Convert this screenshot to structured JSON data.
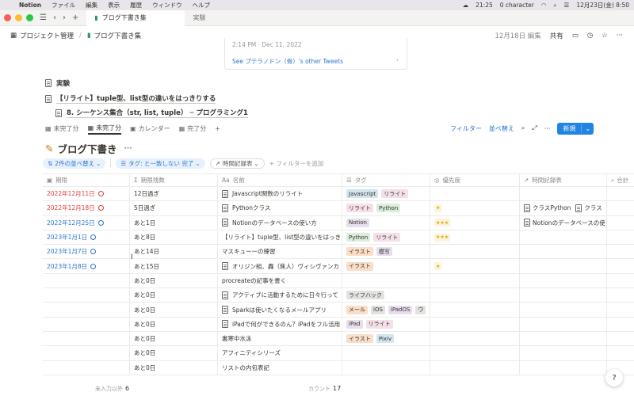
{
  "menubar": {
    "apple": "",
    "app": "Notion",
    "items": [
      "ファイル",
      "編集",
      "表示",
      "履歴",
      "ウィンドウ",
      "ヘルプ"
    ],
    "time": "21:25",
    "char_count": "0 character",
    "datetime": "12月23日(金) 8:50"
  },
  "window": {
    "tab_active": "ブログ下書き集",
    "tab_inactive": "実験"
  },
  "pagebar": {
    "crumb1": "プロジェクト管理",
    "crumb2": "ブログ下書き集",
    "edited": "12月18日 編集",
    "share": "共有"
  },
  "tweet": {
    "time": "2:14 PM · Dec 11, 2022",
    "link": "See プテラノドン（骨）'s other Tweets"
  },
  "blocks": {
    "page1": "実験",
    "page2": "【リライト】tuple型、list型の違いをはっきりする",
    "page3": "8. シーケンス集合（str, list, tuple） ─ プログラミング1"
  },
  "views": {
    "v1": "未完了分",
    "v2": "未完了分",
    "v3": "カレンダー",
    "v4": "完了分",
    "plus": "+",
    "filter": "フィルター",
    "sort": "並べ替え",
    "new": "新規"
  },
  "db": {
    "title": "ブログ下書き",
    "more": "···"
  },
  "filters": {
    "sort": "2件の並べ替え",
    "tag": "タグ: と一致しない 完了",
    "time": "時間記録表",
    "add": "+ フィルターを追加"
  },
  "headers": [
    "期限",
    "期限残数",
    "名前",
    "タグ",
    "優先度",
    "時間記録表",
    "合計"
  ],
  "rows": [
    {
      "date": "2022年12月11日",
      "dc": "red",
      "rem": "12日過ぎ",
      "name": "Javascript関数のリライト",
      "doc": true,
      "tags": [
        [
          "Javascript",
          "#d3e5ef"
        ],
        [
          "リライト",
          "#f5e0e9"
        ]
      ],
      "stars": "",
      "rel": []
    },
    {
      "date": "2022年12月18日",
      "dc": "red",
      "rem": "5日過ぎ",
      "name": "Pythonクラス",
      "doc": true,
      "tags": [
        [
          "リライト",
          "#f5e0e9"
        ],
        [
          "Python",
          "#dbeddb"
        ]
      ],
      "stars": "★",
      "rel": [
        "クラスPython",
        "クラス"
      ]
    },
    {
      "date": "2022年12月25日",
      "dc": "blue",
      "rem": "あと1日",
      "name": "Notionのデータベースの使い方",
      "doc": true,
      "tags": [
        [
          "Notion",
          "#e8deee"
        ]
      ],
      "stars": "★★★",
      "rel": [
        "Notionのデータベースの使"
      ]
    },
    {
      "date": "2023年1月1日",
      "dc": "blue",
      "rem": "あと8日",
      "name": "【リライト】tuple型、list型の違いをはっき",
      "doc": false,
      "tags": [
        [
          "Python",
          "#dbeddb"
        ],
        [
          "リライト",
          "#f5e0e9"
        ]
      ],
      "stars": "★★★",
      "rel": []
    },
    {
      "date": "2023年1月7日",
      "dc": "blue",
      "rem": "あと14日",
      "name": "マスキューーの練習",
      "doc": false,
      "tags": [
        [
          "イラスト",
          "#fadec9"
        ],
        [
          "模写",
          "#e8deee"
        ]
      ],
      "stars": "",
      "rel": []
    },
    {
      "date": "2023年1月8日",
      "dc": "blue",
      "rem": "あと15日",
      "name": "オリジン組、轟（焦人）ヴィシヴァンカ",
      "doc": true,
      "tags": [
        [
          "イラスト",
          "#fadec9"
        ]
      ],
      "stars": "★",
      "rel": []
    },
    {
      "date": "",
      "dc": "",
      "rem": "あと0日",
      "name": "procreateの記事を書く",
      "doc": false,
      "tags": [],
      "stars": "",
      "rel": []
    },
    {
      "date": "",
      "dc": "",
      "rem": "あと0日",
      "name": "アクティブに活動するために日々行って",
      "doc": true,
      "tags": [
        [
          "ライフハック",
          "#e3e2e0"
        ]
      ],
      "stars": "",
      "rel": []
    },
    {
      "date": "",
      "dc": "",
      "rem": "あと0日",
      "name": "Sparkは使いたくなるメールアプリ",
      "doc": true,
      "tags": [
        [
          "メール",
          "#fadec9"
        ],
        [
          "iOS",
          "#e3e2e0"
        ],
        [
          "iPadOS",
          "#e8deee"
        ],
        [
          "ウ",
          "#e3e2e0"
        ]
      ],
      "stars": "",
      "rel": []
    },
    {
      "date": "",
      "dc": "",
      "rem": "あと0日",
      "name": "iPadで何ができるのん？iPadをフル活用",
      "doc": true,
      "tags": [
        [
          "iPad",
          "#e8deee"
        ],
        [
          "リライト",
          "#f5e0e9"
        ]
      ],
      "stars": "",
      "rel": []
    },
    {
      "date": "",
      "dc": "",
      "rem": "あと0日",
      "name": "裏寒中水泳",
      "doc": false,
      "tags": [
        [
          "イラスト",
          "#fadec9"
        ],
        [
          "Pixiv",
          "#d3e5ef"
        ]
      ],
      "stars": "",
      "rel": []
    },
    {
      "date": "",
      "dc": "",
      "rem": "あと0日",
      "name": "アフィニティシリーズ",
      "doc": false,
      "tags": [],
      "stars": "",
      "rel": []
    },
    {
      "date": "",
      "dc": "",
      "rem": "あと0日",
      "name": "リストの内包表記",
      "doc": false,
      "tags": [],
      "stars": "",
      "rel": []
    }
  ],
  "footer": {
    "empty_label": "未入力以外",
    "empty_val": "6",
    "count_label": "カウント",
    "count_val": "17"
  },
  "help": "?"
}
